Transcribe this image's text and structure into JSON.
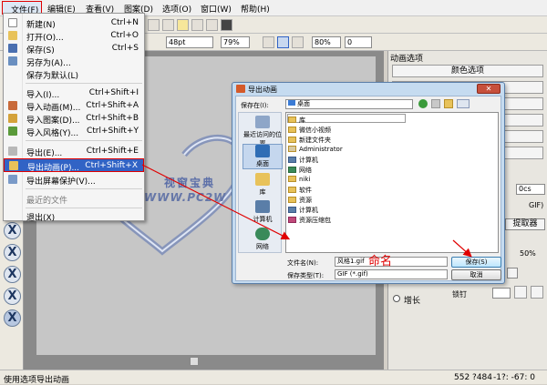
{
  "menubar": {
    "file": "文件(F)",
    "edit": "编辑(E)",
    "view": "查看(V)",
    "pattern": "图案(D)",
    "options": "选项(O)",
    "window": "窗口(W)",
    "help": "帮助(H)"
  },
  "file_menu": {
    "items": [
      {
        "label": "新建(N)",
        "shortcut": "Ctrl+N"
      },
      {
        "label": "打开(O)...",
        "shortcut": "Ctrl+O"
      },
      {
        "label": "保存(S)",
        "shortcut": "Ctrl+S"
      },
      {
        "label": "另存为(A)...",
        "shortcut": ""
      },
      {
        "label": "保存为默认(L)",
        "shortcut": ""
      },
      {
        "label": "导入(I)...",
        "shortcut": "Ctrl+Shift+I"
      },
      {
        "label": "导入动画(M)...",
        "shortcut": "Ctrl+Shift+A"
      },
      {
        "label": "导入图案(D)...",
        "shortcut": "Ctrl+Shift+B"
      },
      {
        "label": "导入风格(Y)...",
        "shortcut": "Ctrl+Shift+Y"
      },
      {
        "label": "导出(E)...",
        "shortcut": "Ctrl+Shift+E"
      },
      {
        "label": "导出动画(P)...",
        "shortcut": "Ctrl+Shift+X"
      },
      {
        "label": "导出屏幕保护(V)...",
        "shortcut": ""
      },
      {
        "label": "最近的文件",
        "shortcut": ""
      },
      {
        "label": "退出(X)",
        "shortcut": ""
      }
    ]
  },
  "toolbar": {
    "font_size": "48pt",
    "zoom": "79%",
    "opacity": "80%",
    "spacing": "0"
  },
  "canvas": {
    "watermark_line1": "视窗宝典",
    "watermark_line2": "WWW.PC2W"
  },
  "dialog": {
    "title": "导出动画",
    "save_in_label": "保存在(I):",
    "save_in_value": "桌面",
    "places": [
      "最近访问的位置",
      "桌面",
      "库",
      "计算机",
      "网络"
    ],
    "files": [
      "库",
      "微信小视频",
      "新建文件夹",
      "Administrator",
      "计算机",
      "网络",
      "niki",
      "软件",
      "资源",
      "计算机",
      "资源压缩包"
    ],
    "filename_label": "文件名(N):",
    "filename_value": "风格1.gif",
    "filetype_label": "保存类型(T):",
    "filetype_value": "GIF (*.gif)",
    "save_button": "保存(S)",
    "cancel_button": "取消"
  },
  "annotation": {
    "rename_label": "命名"
  },
  "right_panel": {
    "title": "动画选项",
    "color_options": "颜色选项",
    "cs_value": "0cs",
    "gif_label": "GIF)",
    "extractor_button": "提取器",
    "percent_value": "50%",
    "grow_label": "增长",
    "lock_label": "锁钉"
  },
  "statusbar": {
    "text": "使用选项导出动画",
    "coords": "552 ?484",
    "extra": "-1?: -67: 0"
  },
  "colors": {
    "highlight_red": "#e00000",
    "menu_selected": "#3163c5",
    "dialog_frame": "#c5dbf0"
  }
}
